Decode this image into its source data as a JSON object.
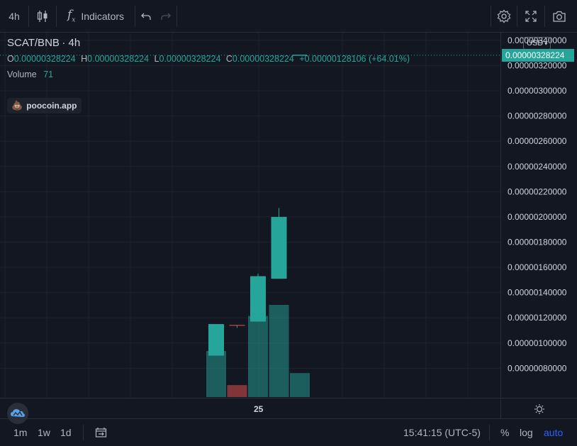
{
  "toolbar": {
    "interval": "4h",
    "indicators_label": "Indicators",
    "icons": [
      "candles-icon",
      "fx-icon",
      "undo-icon",
      "redo-icon",
      "settings-icon",
      "fullscreen-icon",
      "camera-icon"
    ]
  },
  "legend": {
    "pair": "SCAT/BNB",
    "interval": "· 4h",
    "o_label": "O",
    "o_value": "0.00000328224",
    "h_label": "H",
    "h_value": "0.00000328224",
    "l_label": "L",
    "l_value": "0.00000328224",
    "c_label": "C",
    "c_value": "0.00000328224",
    "change": "+0.00000128106 (+64.01%)",
    "volume_label": "Volume",
    "volume_value": "71"
  },
  "watermark": {
    "label": "poocoin.app"
  },
  "price_axis": {
    "currency": "USD",
    "current_price": "0.00000328224"
  },
  "time_axis": {
    "label": "25"
  },
  "bottombar": {
    "ranges": [
      "1m",
      "1w",
      "1d"
    ],
    "time": "15:41:15 (UTC-5)",
    "percent": "%",
    "log": "log",
    "auto": "auto"
  },
  "colors": {
    "up": "#26a69a",
    "down": "#ef5350",
    "bg": "#131722",
    "grid": "#1e222d"
  },
  "chart_data": {
    "type": "candlestick",
    "x_label": "25",
    "ylim": [
      6.5e-07,
      3.45e-06
    ],
    "y_ticks": [
      "0.00000340000",
      "0.00000320000",
      "0.00000300000",
      "0.00000280000",
      "0.00000260000",
      "0.00000240000",
      "0.00000220000",
      "0.00000200000",
      "0.00000180000",
      "0.00000160000",
      "0.00000140000",
      "0.00000120000",
      "0.00000100000",
      "0.00000080000"
    ],
    "candles": [
      {
        "open": 9e-07,
        "high": 1.15e-06,
        "low": 9e-07,
        "close": 1.15e-06
      },
      {
        "open": 1.14e-06,
        "high": 1.14e-06,
        "low": 1.12e-06,
        "close": 1.14e-06
      },
      {
        "open": 1.17e-06,
        "high": 1.55e-06,
        "low": 1.17e-06,
        "close": 1.53e-06
      },
      {
        "open": 1.51e-06,
        "high": 2.07e-06,
        "low": 1.51e-06,
        "close": 2e-06
      },
      {
        "open": 3.28224e-06,
        "high": 3.28224e-06,
        "low": 3.28224e-06,
        "close": 3.28224e-06
      }
    ],
    "volumes": [
      {
        "value": 50,
        "up": true
      },
      {
        "value": 13,
        "up": false
      },
      {
        "value": 88,
        "up": true
      },
      {
        "value": 100,
        "up": true
      },
      {
        "value": 26,
        "up": true
      }
    ]
  }
}
